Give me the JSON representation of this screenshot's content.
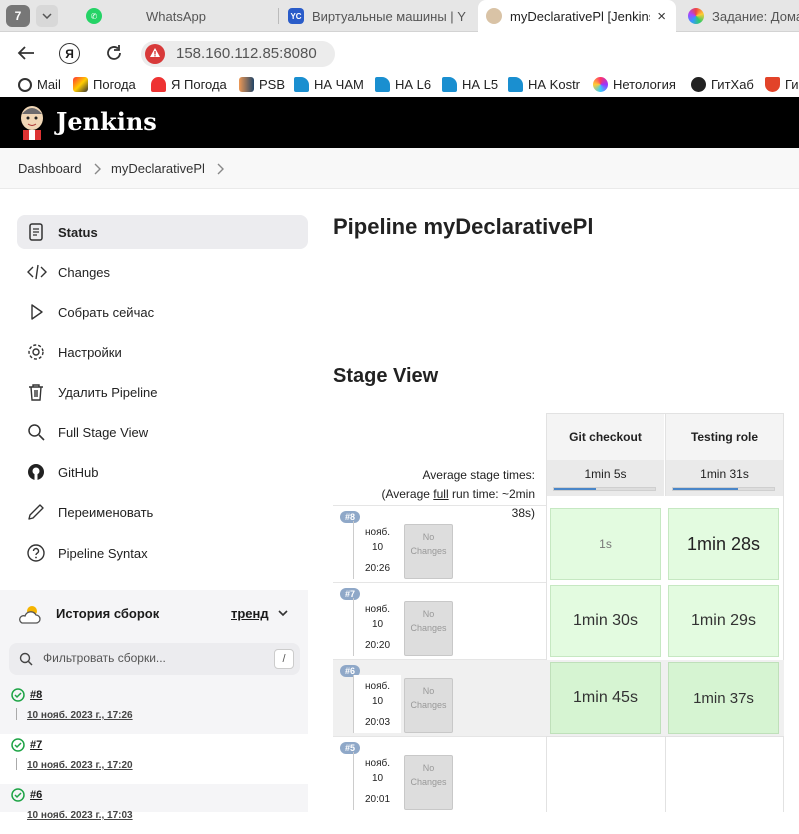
{
  "browser": {
    "tabs": [
      {
        "label": "WhatsApp"
      },
      {
        "label": "Виртуальные машины | Y"
      },
      {
        "label": "myDeclarativePl [Jenkins]",
        "close": "×"
      },
      {
        "label": "Задание: Дома"
      }
    ],
    "tab_counter": "7",
    "url": "158.160.112.85:8080",
    "bookmarks": [
      "Mail",
      "Погода",
      "Я Погода",
      "PSB",
      "НА ЧАМ",
      "НА L6",
      "НА L5",
      "НА Kostr",
      "Нетология",
      "ГитХаб",
      "Ги"
    ]
  },
  "jenkins": {
    "brand": "Jenkins",
    "breadcrumb": [
      "Dashboard",
      "myDeclarativePl"
    ],
    "sidebar": [
      {
        "label": "Status",
        "icon": "status-icon"
      },
      {
        "label": "Changes",
        "icon": "code-icon"
      },
      {
        "label": "Собрать сейчас",
        "icon": "play-icon"
      },
      {
        "label": "Настройки",
        "icon": "gear-icon"
      },
      {
        "label": "Удалить Pipeline",
        "icon": "trash-icon"
      },
      {
        "label": "Full Stage View",
        "icon": "search-icon"
      },
      {
        "label": "GitHub",
        "icon": "github-icon"
      },
      {
        "label": "Переименовать",
        "icon": "pencil-icon"
      },
      {
        "label": "Pipeline Syntax",
        "icon": "help-icon"
      }
    ],
    "history": {
      "title": "История сборок",
      "trend": "тренд",
      "filter_placeholder": "Фильтровать сборки...",
      "filter_key": "/",
      "builds": [
        {
          "id": "#8",
          "date": "10 нояб. 2023 г., 17:26"
        },
        {
          "id": "#7",
          "date": "10 нояб. 2023 г., 17:20"
        },
        {
          "id": "#6",
          "date": "10 нояб. 2023 г., 17:03"
        }
      ]
    },
    "page_title": "Pipeline myDeclarativePl",
    "stage_view": {
      "title": "Stage View",
      "avg_label": "Average stage times:",
      "avg_full_prefix": "(Average ",
      "avg_full_link": "full",
      "avg_full_suffix": " run time: ~2min",
      "avg_full_tail": "38s)",
      "stages": [
        {
          "name": "Git checkout",
          "avg": "1min 5s",
          "bar_fraction": 0.42
        },
        {
          "name": "Testing role",
          "avg": "1min 31s",
          "bar_fraction": 0.64
        }
      ],
      "no_changes": "No Changes",
      "runs": [
        {
          "badge": "#8",
          "month": "нояб.",
          "day": "10",
          "time": "20:26",
          "durations": [
            "1s",
            "1min 28s"
          ]
        },
        {
          "badge": "#7",
          "month": "нояб.",
          "day": "10",
          "time": "20:20",
          "durations": [
            "1min 30s",
            "1min 29s"
          ]
        },
        {
          "badge": "#6",
          "month": "нояб.",
          "day": "10",
          "time": "20:03",
          "durations": [
            "1min 45s",
            "1min 37s"
          ]
        },
        {
          "badge": "#5",
          "month": "нояб.",
          "day": "10",
          "time": "20:01",
          "durations": [
            "",
            ""
          ]
        }
      ]
    }
  }
}
